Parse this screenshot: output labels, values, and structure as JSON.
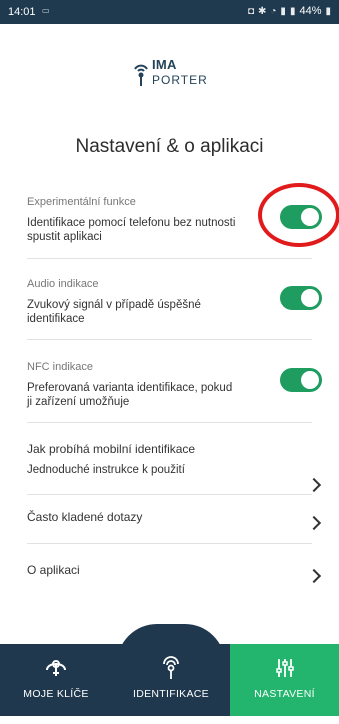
{
  "status": {
    "time": "14:01",
    "battery": "44%"
  },
  "logo": {
    "line1": "IMA",
    "line2": "PORTER"
  },
  "page": {
    "title": "Nastavení & o aplikaci"
  },
  "settings": [
    {
      "label": "Experimentální funkce",
      "desc": "Identifikace pomocí telefonu bez nutnosti spustit aplikaci",
      "on": true
    },
    {
      "label": "Audio indikace",
      "desc": "Zvukový signál v případě úspěšné identifikace",
      "on": true
    },
    {
      "label": "NFC indikace",
      "desc": "Preferovaná varianta identifikace, pokud ji zařízení umožňuje",
      "on": true
    }
  ],
  "links": [
    {
      "title": "Jak probíhá mobilní identifikace",
      "subtitle": "Jednoduché instrukce k použití"
    },
    {
      "title": "Často kladené dotazy"
    },
    {
      "title": "O aplikaci"
    }
  ],
  "nav": [
    {
      "label": "MOJE KLÍČE",
      "icon": "key-icon"
    },
    {
      "label": "IDENTIFIKACE",
      "icon": "fingerprint-key-icon"
    },
    {
      "label": "NASTAVENÍ",
      "icon": "sliders-icon",
      "active": true
    }
  ],
  "colors": {
    "accent": "#23b56e",
    "toggle": "#1f9c5f",
    "navbar": "#20384d",
    "highlight": "#e11b1b"
  }
}
